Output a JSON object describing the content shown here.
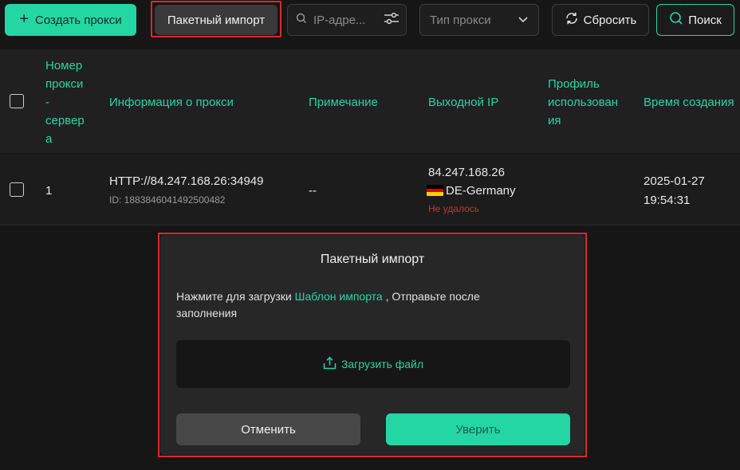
{
  "toolbar": {
    "create_label": "Создать прокси",
    "batch_import_label": "Пакетный импорт",
    "search_placeholder": "IP-адре...",
    "proxy_type_placeholder": "Тип прокси",
    "reset_label": "Сбросить",
    "search_label": "Поиск"
  },
  "table": {
    "headers": {
      "number": [
        "Номер",
        "прокси",
        "-",
        "сервер",
        "а"
      ],
      "info": "Информация о прокси",
      "note": "Примечание",
      "exit_ip": "Выходной IP",
      "profile": [
        "Профиль",
        "использован",
        "ия"
      ],
      "created": "Время создания"
    },
    "rows": [
      {
        "number": "1",
        "proxy": "HTTP://84.247.168.26:34949",
        "id": "ID: 1883846041492500482",
        "note": "--",
        "exit_ip": "84.247.168.26",
        "country": "DE-Germany",
        "status": "Не удалось",
        "created_date": "2025-01-27",
        "created_time": "19:54:31"
      }
    ]
  },
  "modal": {
    "title": "Пакетный импорт",
    "text_before": "Нажмите для загрузки ",
    "template_link": "Шаблон импорта",
    "text_after": " ,  Отправьте после заполнения",
    "upload_label": "Загрузить файл",
    "cancel_label": "Отменить",
    "confirm_label": "Уверить"
  },
  "colors": {
    "accent": "#25d6a5",
    "highlight": "#e0262d",
    "error": "#c0392b"
  }
}
